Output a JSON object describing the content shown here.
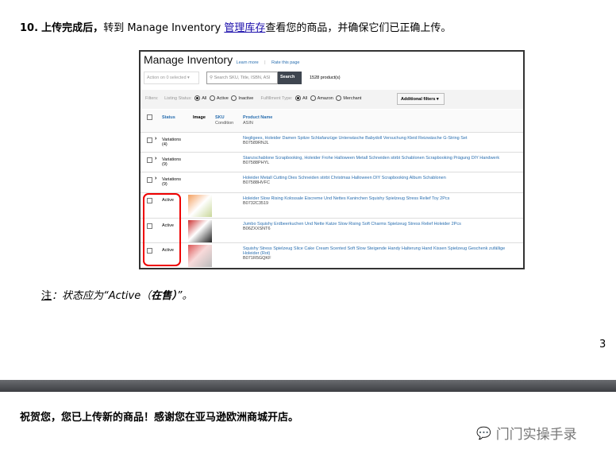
{
  "step": {
    "number": "10.",
    "bold": "上传完成后，",
    "text1": "转到 Manage Inventory ",
    "link": "管理库存",
    "text2": "查看您的商品，并确保它们已正确上传。"
  },
  "shot": {
    "title": "Manage Inventory",
    "learn_more": "Learn more",
    "sep": "|",
    "rate": "Rate this page",
    "action": "Action on 0 selected ▾",
    "search_placeholder": "Search SKU, Title, ISBN, ASI",
    "search_btn": "Search",
    "count": "1528 product(s)",
    "filters_label": "Filters:",
    "listing_status": "Listing Status:",
    "ls_options": [
      "All",
      "Active",
      "Inactive"
    ],
    "fulfillment": "Fulfillment Type:",
    "ff_options": [
      "All",
      "Amazon",
      "Merchant"
    ],
    "additional": "Additional filters ▾",
    "headers": {
      "status": "Status",
      "image": "Image",
      "sku": "SKU",
      "condition": "Condition",
      "product": "Product Name",
      "asin": "ASIN"
    },
    "rows": [
      {
        "status": "Variations",
        "sub": "(4)",
        "name": "Negligees, Holeider Damen Spitze Schlafanzüge Unterwäsche Babydoll Versuchung Kleid Reizwäsche G-String Set",
        "asin": "B07589RNJL"
      },
      {
        "status": "Variations",
        "sub": "(9)",
        "name": "Stanzschablone Scrapbooking, Holeider Frohe Halloween Metall Schneiden stirbt Schablonen Scrapbooking Prägung DIY Handwerk",
        "asin": "B07588PHYL"
      },
      {
        "status": "Variations",
        "sub": "(9)",
        "name": "Holeider Metall Cutting Dies Schneiden stirbt Christmas Halloween DIY Scrapbooking Album Schablonen",
        "asin": "B07588HVFC"
      },
      {
        "status": "Active",
        "sub": "",
        "name": "Holeider Slow Rising Kolossale Eiscreme Und Nettes Kaninchen Squishy Spielzeug Stress Relief Toy 2Pcs",
        "asin": "B0732C3519"
      },
      {
        "status": "Active",
        "sub": "",
        "name": "Jumbo Squishy Erdbeerkuchen Und Nette Katze Slow Rising Soft Charms Spielzeug Stress Relief Holeider 2Pcs",
        "asin": "B06ZXXSNT6"
      },
      {
        "status": "Active",
        "sub": "",
        "name": "Squishy Stress Spielzeug Slice Cake Cream Scented Soft Slow Steigende Handy Halterung Hand Kissen Spielzeug Geschenk zufällige Holeider (Rot)",
        "asin": "B071R5GQKF"
      }
    ]
  },
  "note": {
    "label": "注",
    "colon": "：",
    "text": "状态应为“Active（",
    "bold": "在售）",
    "end": "”。"
  },
  "page_number": "3",
  "congrats": "祝贺您，您已上传新的商品！感谢您在亚马逊欧洲商城开店。",
  "watermark": "门门实操手录"
}
